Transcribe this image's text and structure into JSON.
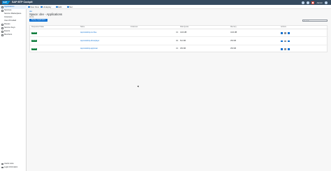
{
  "shell": {
    "brand": "SAP",
    "title": "SAP BTP Cockpit",
    "user_label": "Admin"
  },
  "toolbar": {
    "items": [
      {
        "label": "New View"
      },
      {
        "label": "Undeploy"
      },
      {
        "label": "Edit"
      },
      {
        "label": "Set"
      }
    ]
  },
  "sidebar": {
    "items": [
      {
        "label": "Applications",
        "selected": true
      },
      {
        "label": "Services"
      },
      {
        "label": "Service Marketplace"
      },
      {
        "label": "Instances"
      },
      {
        "label": "User-Provided"
      },
      {
        "label": "Routes"
      },
      {
        "label": "Service Keys"
      },
      {
        "label": "Events"
      },
      {
        "label": "Members"
      }
    ],
    "bottom": [
      {
        "label": "Useful Links"
      },
      {
        "label": "Legal Information"
      }
    ]
  },
  "page": {
    "breadcrumb": "dev",
    "title": "Space: dev - Applications",
    "subtitle": "All (3)",
    "deploy_button": "Deploy Application",
    "search_placeholder": "Search"
  },
  "table": {
    "columns": [
      "Requested State",
      "Name",
      "Instances",
      "Disk Quota",
      "Memory",
      "Actions"
    ],
    "rows": [
      {
        "state": "Started",
        "name": "cap-bookshop-srv-blue",
        "instances": "1/1",
        "disk": "1024 MB",
        "memory": "1024 MB"
      },
      {
        "state": "Started",
        "name": "cap-bookshop-db-deployer",
        "instances": "0/1",
        "disk": "512 MB",
        "memory": "256 MB"
      },
      {
        "state": "Started",
        "name": "cap-bookshop-approuter",
        "instances": "1/1",
        "disk": "256 MB",
        "memory": "256 MB"
      }
    ]
  },
  "colors": {
    "shell": "#354a5f",
    "accent": "#0a6ed1",
    "started": "#107e3e"
  }
}
